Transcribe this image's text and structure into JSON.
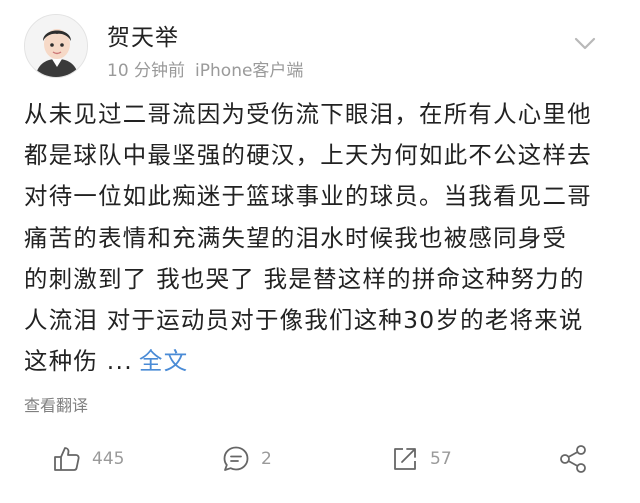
{
  "post": {
    "author": "贺天举",
    "time": "10 分钟前",
    "source": "iPhone客户端",
    "lines": [
      "从未见过二哥流因为受伤流下眼泪，在所有人心里他",
      "都是球队中最坚强的硬汉，上天为何如此不公这样去",
      "对待一位如此痴迷于篮球事业的球员。当我看见二哥",
      "痛苦的表情和充满失望的泪水时候我也被感同身受",
      "的刺激到了 我也哭了 我是替这样的拼命这种努力的",
      "人流泪 对于运动员对于像我们这种30岁的老将来说",
      "这种伤 ..."
    ],
    "more_label": "全文",
    "translate_label": "查看翻译"
  },
  "actions": {
    "like_count": "445",
    "comment_count": "2",
    "repost_count": "57"
  },
  "colors": {
    "link": "#4a8bd6",
    "meta": "#9a9a9a",
    "icon": "#666666"
  },
  "icons": [
    "avatar",
    "chevron-down-icon",
    "thumbs-up-icon",
    "comment-icon",
    "repost-icon",
    "share-icon"
  ]
}
